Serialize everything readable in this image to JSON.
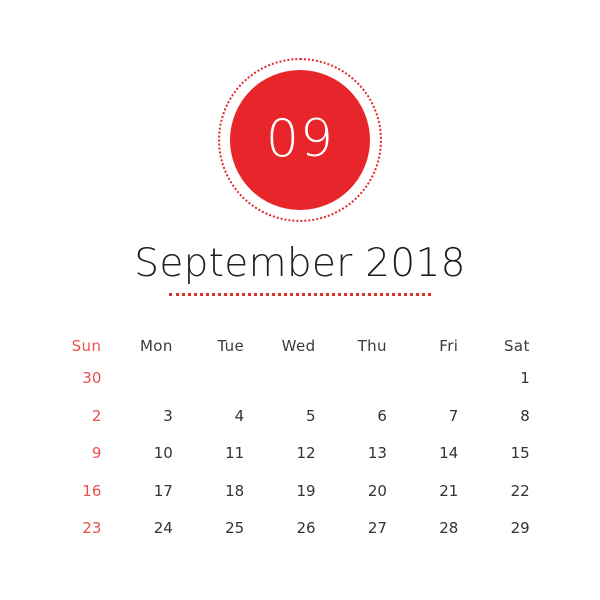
{
  "badge": {
    "month_number": "09",
    "circle_color": "#e8252a",
    "ring_style": "dotted",
    "number_color": "#ffffff"
  },
  "title": {
    "text": "September 2018",
    "month": "September",
    "year": "2018",
    "color": "#231f20",
    "underline_color": "#d9342b",
    "underline_style": "dotted"
  },
  "calendar": {
    "weekdays": [
      {
        "label": "Sun",
        "highlight": true
      },
      {
        "label": "Mon",
        "highlight": false
      },
      {
        "label": "Tue",
        "highlight": false
      },
      {
        "label": "Wed",
        "highlight": false
      },
      {
        "label": "Thu",
        "highlight": false
      },
      {
        "label": "Fri",
        "highlight": false
      },
      {
        "label": "Sat",
        "highlight": false
      }
    ],
    "weekday_highlight_color": "#ea5450",
    "weekday_color": "#3b3b3b",
    "date_color": "#333333",
    "sunday_date_color": "#e8504c",
    "weeks": [
      [
        {
          "day": "30",
          "sunday": true,
          "empty": false
        },
        {
          "day": "",
          "sunday": false,
          "empty": true
        },
        {
          "day": "",
          "sunday": false,
          "empty": true
        },
        {
          "day": "",
          "sunday": false,
          "empty": true
        },
        {
          "day": "",
          "sunday": false,
          "empty": true
        },
        {
          "day": "",
          "sunday": false,
          "empty": true
        },
        {
          "day": "1",
          "sunday": false,
          "empty": false
        }
      ],
      [
        {
          "day": "2",
          "sunday": true,
          "empty": false
        },
        {
          "day": "3",
          "sunday": false,
          "empty": false
        },
        {
          "day": "4",
          "sunday": false,
          "empty": false
        },
        {
          "day": "5",
          "sunday": false,
          "empty": false
        },
        {
          "day": "6",
          "sunday": false,
          "empty": false
        },
        {
          "day": "7",
          "sunday": false,
          "empty": false
        },
        {
          "day": "8",
          "sunday": false,
          "empty": false
        }
      ],
      [
        {
          "day": "9",
          "sunday": true,
          "empty": false
        },
        {
          "day": "10",
          "sunday": false,
          "empty": false
        },
        {
          "day": "11",
          "sunday": false,
          "empty": false
        },
        {
          "day": "12",
          "sunday": false,
          "empty": false
        },
        {
          "day": "13",
          "sunday": false,
          "empty": false
        },
        {
          "day": "14",
          "sunday": false,
          "empty": false
        },
        {
          "day": "15",
          "sunday": false,
          "empty": false
        }
      ],
      [
        {
          "day": "16",
          "sunday": true,
          "empty": false
        },
        {
          "day": "17",
          "sunday": false,
          "empty": false
        },
        {
          "day": "18",
          "sunday": false,
          "empty": false
        },
        {
          "day": "19",
          "sunday": false,
          "empty": false
        },
        {
          "day": "20",
          "sunday": false,
          "empty": false
        },
        {
          "day": "21",
          "sunday": false,
          "empty": false
        },
        {
          "day": "22",
          "sunday": false,
          "empty": false
        }
      ],
      [
        {
          "day": "23",
          "sunday": true,
          "empty": false
        },
        {
          "day": "24",
          "sunday": false,
          "empty": false
        },
        {
          "day": "25",
          "sunday": false,
          "empty": false
        },
        {
          "day": "26",
          "sunday": false,
          "empty": false
        },
        {
          "day": "27",
          "sunday": false,
          "empty": false
        },
        {
          "day": "28",
          "sunday": false,
          "empty": false
        },
        {
          "day": "29",
          "sunday": false,
          "empty": false
        }
      ]
    ]
  }
}
